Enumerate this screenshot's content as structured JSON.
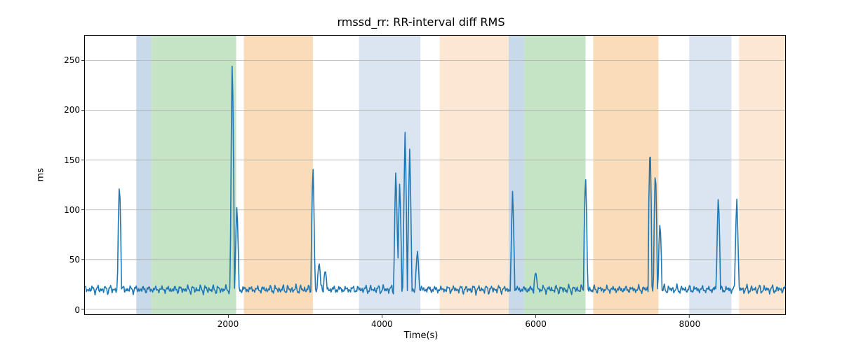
{
  "chart_data": {
    "type": "line",
    "title": "rmssd_rr: RR-interval diff RMS",
    "xlabel": "Time(s)",
    "ylabel": "ms",
    "xlim": [
      130,
      9250
    ],
    "ylim": [
      -5,
      275
    ],
    "xticks": [
      2000,
      4000,
      6000,
      8000
    ],
    "yticks": [
      0,
      50,
      100,
      150,
      200,
      250
    ],
    "grid": true,
    "spans": [
      {
        "start": 800,
        "end": 1000,
        "color": "#c8d9ea"
      },
      {
        "start": 1000,
        "end": 2100,
        "color": "#c5e4c6"
      },
      {
        "start": 2200,
        "end": 3100,
        "color": "#fbdcb9"
      },
      {
        "start": 3700,
        "end": 4500,
        "color": "#dbe5f1"
      },
      {
        "start": 4750,
        "end": 5650,
        "color": "#fce8d2"
      },
      {
        "start": 5650,
        "end": 5850,
        "color": "#c8d9ea"
      },
      {
        "start": 5850,
        "end": 6650,
        "color": "#c5e4c6"
      },
      {
        "start": 6750,
        "end": 7600,
        "color": "#fbdcb9"
      },
      {
        "start": 8000,
        "end": 8550,
        "color": "#dbe5f1"
      },
      {
        "start": 8650,
        "end": 9250,
        "color": "#fce8d2"
      }
    ],
    "series": [
      {
        "name": "rmssd_rr",
        "color": "#1f77b4",
        "baseline_mean": 20,
        "baseline_noise": 6,
        "spikes": [
          {
            "x": 580,
            "y": 131
          },
          {
            "x": 2050,
            "y": 260
          },
          {
            "x": 2110,
            "y": 106
          },
          {
            "x": 3100,
            "y": 148
          },
          {
            "x": 3180,
            "y": 48
          },
          {
            "x": 3260,
            "y": 40
          },
          {
            "x": 4180,
            "y": 144
          },
          {
            "x": 4230,
            "y": 130
          },
          {
            "x": 4300,
            "y": 180
          },
          {
            "x": 4360,
            "y": 162
          },
          {
            "x": 4460,
            "y": 60
          },
          {
            "x": 5700,
            "y": 120
          },
          {
            "x": 6000,
            "y": 38
          },
          {
            "x": 6650,
            "y": 139
          },
          {
            "x": 7490,
            "y": 172
          },
          {
            "x": 7560,
            "y": 145
          },
          {
            "x": 7620,
            "y": 90
          },
          {
            "x": 8380,
            "y": 116
          },
          {
            "x": 8620,
            "y": 113
          }
        ]
      }
    ]
  }
}
